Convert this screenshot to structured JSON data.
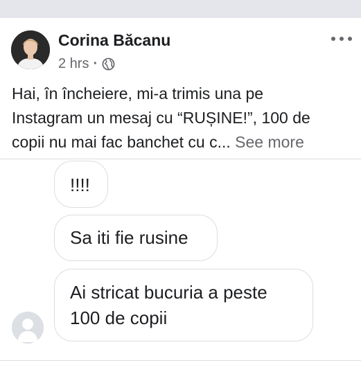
{
  "post": {
    "author_name": "Corina Băcanu",
    "timestamp": "2 hrs",
    "separator": "·",
    "audience_icon": "globe-icon",
    "more_icon": "more-options-icon",
    "text_lines": [
      "Hai, în încheiere, mi-a trimis una pe",
      "Instagram un mesaj cu “RUȘINE!”, 100 de",
      "copii nu mai fac banchet cu c..."
    ],
    "see_more_label": "See more"
  },
  "messages": [
    {
      "text": "!!!!"
    },
    {
      "text": "Sa iti fie rusine"
    },
    {
      "text_lines": [
        "Ai stricat bucuria a peste",
        "100 de copii"
      ]
    }
  ],
  "sender_avatar_icon": "default-profile-icon",
  "colors": {
    "top_band": "#e4e6eb",
    "text_primary": "#1c1e21",
    "text_secondary": "#65676b",
    "bubble_border": "#dadde1"
  }
}
